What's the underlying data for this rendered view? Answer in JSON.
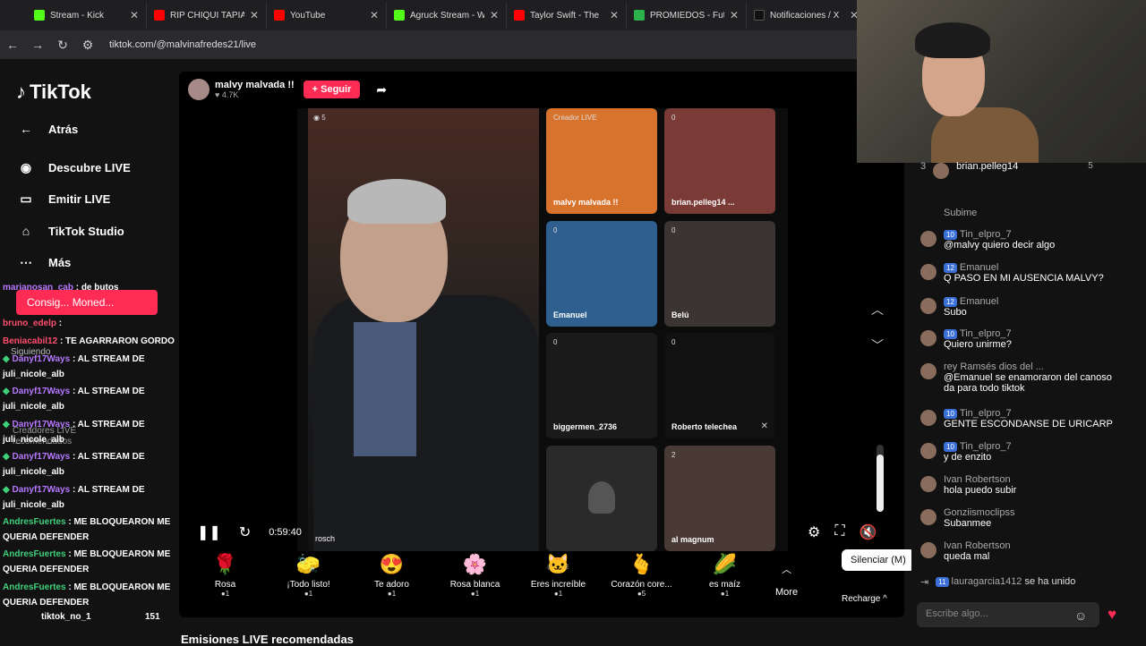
{
  "browser": {
    "tabs": [
      {
        "title": "Stream - Kick",
        "color": "#53fc18"
      },
      {
        "title": "RIP CHIQUI TAPIA",
        "color": "#ff0000"
      },
      {
        "title": "YouTube",
        "color": "#ff0000"
      },
      {
        "title": "Agruck Stream - W",
        "color": "#53fc18"
      },
      {
        "title": "Taylor Swift - The",
        "color": "#ff0000"
      },
      {
        "title": "PROMIEDOS - Fut",
        "color": "#2bb24c"
      },
      {
        "title": "Notificaciones / X",
        "color": "#111111"
      }
    ],
    "url": "tiktok.com/@malvinafredes21/live"
  },
  "sidebar": {
    "logo": "TikTok",
    "items": [
      {
        "label": "Atrás",
        "icon": "arrow-left-icon"
      },
      {
        "label": "Descubre LIVE",
        "icon": "live-avatar-icon"
      },
      {
        "label": "Emitir LIVE",
        "icon": "camera-icon"
      },
      {
        "label": "TikTok Studio",
        "icon": "studio-icon"
      },
      {
        "label": "Más",
        "icon": "more-icon"
      }
    ]
  },
  "overlay_chat": [
    {
      "user": "marianosan_cab",
      "text": ": de butos"
    },
    {
      "user": "bruno_edelp",
      "text": ":"
    },
    {
      "user": "Beniacabil12",
      "text": ": TE AGARRARON GORDO"
    },
    {
      "user": "Danyf17Ways",
      "text": ": AL STREAM DE"
    },
    {
      "user": "juli_nicole_alb",
      "text": ""
    },
    {
      "user": "Danyf17Ways",
      "text": ": AL STREAM DE"
    },
    {
      "user": "juli_nicole_alb",
      "text": ""
    },
    {
      "user": "Danyf17Ways",
      "text": ": AL STREAM DE"
    },
    {
      "user": "juli_nicole_alb",
      "text": ""
    },
    {
      "user": "Danyf17Ways",
      "text": ": AL STREAM DE"
    },
    {
      "user": "juli_nicole_alb",
      "text": ""
    },
    {
      "user": "Danyf17Ways",
      "text": ": AL STREAM DE"
    },
    {
      "user": "juli_nicole_alb",
      "text": ""
    },
    {
      "user": "AndresFuertes",
      "text": ": ME BLOQUEARON ME"
    },
    {
      "user": "QUERIA DEFENDER",
      "text": ""
    },
    {
      "user": "AndresFuertes",
      "text": ": ME BLOQUEARON ME"
    },
    {
      "user": "QUERIA DEFENDER",
      "text": ""
    },
    {
      "user": "AndresFuertes",
      "text": ": ME BLOQUEARON ME"
    },
    {
      "user": "QUERIA DEFENDER",
      "text": ""
    }
  ],
  "overlay_misc": {
    "coin_button": "Consig... Moned...",
    "siguiendo": "Siguiendo",
    "creadores": "Creadores LIVE recomendados",
    "bottom_user": "tiktok_no_1",
    "bottom_count": "151"
  },
  "live": {
    "host_name": "malvy malvada !!",
    "host_likes": "4.7K",
    "follow_label": "+ Seguir",
    "main_label": "rosch",
    "main_count": "5",
    "time": "0:59:40",
    "tooltip": "Silenciar (M)",
    "volume": 0.85,
    "recharge": "Recharge",
    "recommended": "Emisiones LIVE recomendadas",
    "tiles": [
      {
        "label": "malvy malvada !!",
        "count": "Creador LIVE",
        "bg": "#d8732d"
      },
      {
        "label": "brian.pelleg14 ...",
        "count": "0",
        "bg": "#7a3a36"
      },
      {
        "label": "Emanuel",
        "count": "0",
        "bg": "#2f5f8f"
      },
      {
        "label": "Belú",
        "count": "0",
        "bg": "#3a3432"
      },
      {
        "label": "biggermen_2736",
        "count": "0",
        "bg": "#1a1a1a"
      },
      {
        "label": "Roberto telechea",
        "count": "0",
        "bg": "#111111"
      },
      {
        "label": "",
        "count": "",
        "bg": "#2a2a2a"
      },
      {
        "label": "al magnum",
        "count": "2",
        "bg": "#4a3a35"
      }
    ]
  },
  "gifts": [
    {
      "name": "Rosa",
      "price": "1",
      "icon": "🌹"
    },
    {
      "name": "¡Todo listo!",
      "price": "1",
      "icon": "🧽"
    },
    {
      "name": "Te adoro",
      "price": "1",
      "icon": "😍"
    },
    {
      "name": "Rosa blanca",
      "price": "1",
      "icon": "🌸"
    },
    {
      "name": "Eres increíble",
      "price": "1",
      "icon": "🐱"
    },
    {
      "name": "Corazón core...",
      "price": "5",
      "icon": "🫰"
    },
    {
      "name": "es maíz",
      "price": "1",
      "icon": "🌽"
    }
  ],
  "more_label": "More",
  "chat": {
    "top_user": "brian.pelleg14",
    "top_count": "5",
    "messages": [
      {
        "user": "",
        "badge": "",
        "text": "Subime"
      },
      {
        "user": "Tin_elpro_7",
        "badge": "10",
        "text": "@malvy quiero decir algo"
      },
      {
        "user": "Emanuel",
        "badge": "12",
        "text": "Q PASO EN MI AUSENCIA MALVY?"
      },
      {
        "user": "Emanuel",
        "badge": "12",
        "text": "Subo"
      },
      {
        "user": "Tin_elpro_7",
        "badge": "10",
        "text": "Quiero unirme?"
      },
      {
        "user": "rey Ramsés dios del ...",
        "badge": "",
        "text": "@Emanuel se enamoraron del canoso da para todo tiktok"
      },
      {
        "user": "Tin_elpro_7",
        "badge": "10",
        "text": "GENTE ESCONDANSE DE URICARP"
      },
      {
        "user": "Tin_elpro_7",
        "badge": "10",
        "text": "y de enzito"
      },
      {
        "user": "Ivan Robertson",
        "badge": "",
        "text": "hola puedo subir"
      },
      {
        "user": "Gonziismoclipss",
        "badge": "",
        "text": "Subanmee"
      },
      {
        "user": "Ivan Robertson",
        "badge": "",
        "text": "queda mal"
      }
    ],
    "join_user": "lauragarcia1412",
    "join_badge": "11",
    "join_text": "se ha unido",
    "input_placeholder": "Escribe algo..."
  }
}
